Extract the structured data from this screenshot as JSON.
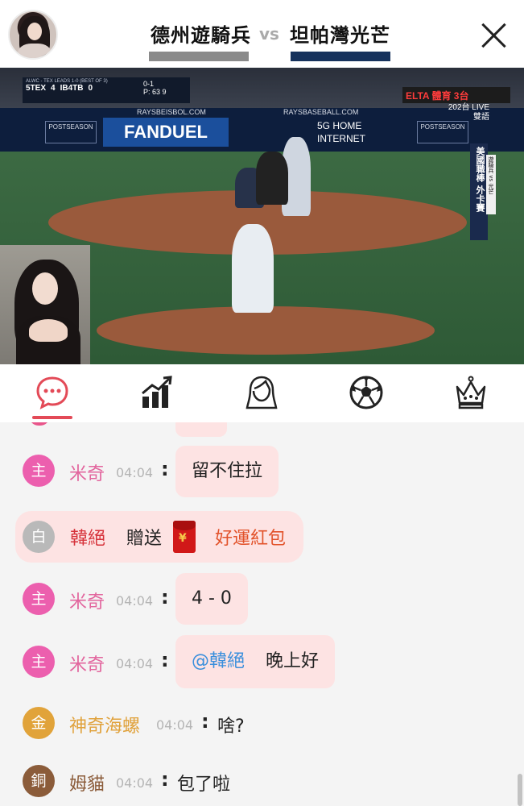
{
  "header": {
    "home_team": "德州遊騎兵",
    "vs": "vs",
    "away_team": "坦帕灣光芒",
    "colors": {
      "home_bar": "#8a8a8a",
      "away_bar": "#16325c"
    }
  },
  "video": {
    "scorebug": {
      "title": "ALWC - TEX LEADS 1-0 (BEST OF 3)",
      "away_abbr": "5TEX",
      "away_score": "4",
      "home_abbr": "IB4TB",
      "home_score": "0",
      "count": "0-1",
      "pitcher": "P: 63",
      "out": "9"
    },
    "ads": {
      "url_left": "RAYSBEISBOL.COM",
      "url_right": "RAYSBASEBALL.COM",
      "fanduel": "FANDUEL",
      "tmobile_line1": "5G HOME",
      "tmobile_line2": "INTERNET",
      "postseason": "POSTSEASON"
    },
    "broadcast": {
      "channel": "ELTA 體育 3台",
      "live": "202台 LIVE",
      "audio": "雙語",
      "vertical_tag": "美國職棒 外卡賽",
      "mini_tag": "遊騎兵 vs 光芒"
    }
  },
  "tabs": [
    {
      "name": "chat",
      "icon": "chat-bubble-icon",
      "active": true
    },
    {
      "name": "stats",
      "icon": "bar-chart-icon",
      "active": false
    },
    {
      "name": "anchor",
      "icon": "female-avatar-icon",
      "active": false
    },
    {
      "name": "sports",
      "icon": "soccer-ball-icon",
      "active": false
    },
    {
      "name": "ranking",
      "icon": "crown-icon",
      "active": false
    }
  ],
  "chat": {
    "messages": [
      {
        "badge": "主",
        "name": "米奇",
        "time": "04:04",
        "text": "留不住拉"
      },
      {
        "badge": "主",
        "name": "米奇",
        "time": "04:04",
        "text": "4 - 0"
      },
      {
        "badge": "主",
        "name": "米奇",
        "time": "04:04",
        "mention": "@韓絕",
        "text": "晚上好"
      },
      {
        "badge": "金",
        "name": "神奇海螺",
        "time": "04:04",
        "text": "啥?"
      },
      {
        "badge": "銅",
        "name": "姆貓",
        "time": "04:04",
        "text": "包了啦"
      }
    ],
    "gift": {
      "badge": "白",
      "name": "韓絕",
      "verb": "贈送",
      "item": "好運紅包"
    },
    "colors": {
      "host_badge": "#ec5fae",
      "bubble": "#fde3e3",
      "gold": "#e0a13a",
      "copper": "#8b5c3a",
      "accent": "#e34a57"
    }
  }
}
